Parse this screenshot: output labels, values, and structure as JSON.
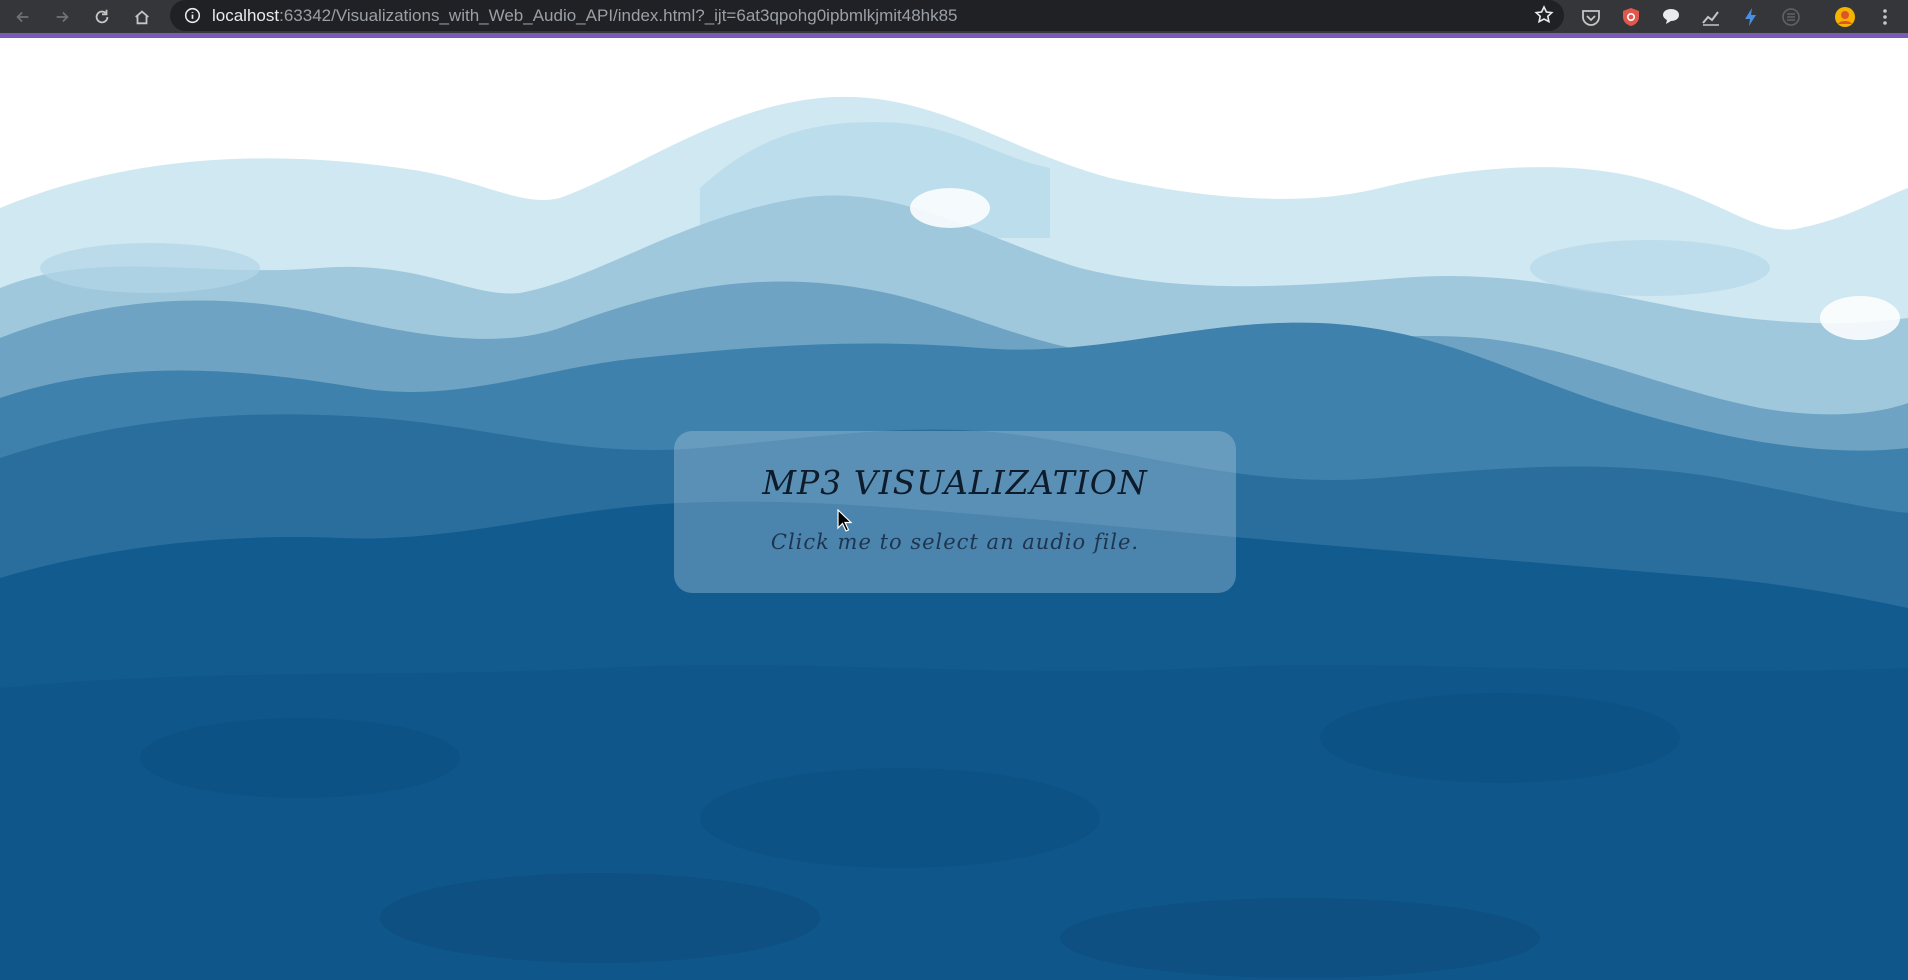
{
  "browser": {
    "url_host": "localhost",
    "url_path": ":63342/Visualizations_with_Web_Audio_API/index.html?_ijt=6at3qpohg0ipbmlkjmit48hk85",
    "nav_icons": [
      "back-arrow-icon",
      "forward-arrow-icon",
      "reload-icon",
      "home-icon"
    ],
    "extension_icons": [
      "pocket-icon",
      "shield-icon",
      "chat-icon",
      "chart-icon",
      "bolt-icon",
      "translate-icon",
      "profile-avatar-icon",
      "menu-kebab-icon"
    ],
    "accent_color": "#7a5ab8"
  },
  "page": {
    "title": "MP3 VISUALIZATION",
    "subtitle": "Click me to select an audio file.",
    "colors": {
      "sky": "#ffffff",
      "wave_light": "#cde6f1",
      "wave_mid": "#8db9d3",
      "wave_deep": "#0f5a8c"
    }
  }
}
